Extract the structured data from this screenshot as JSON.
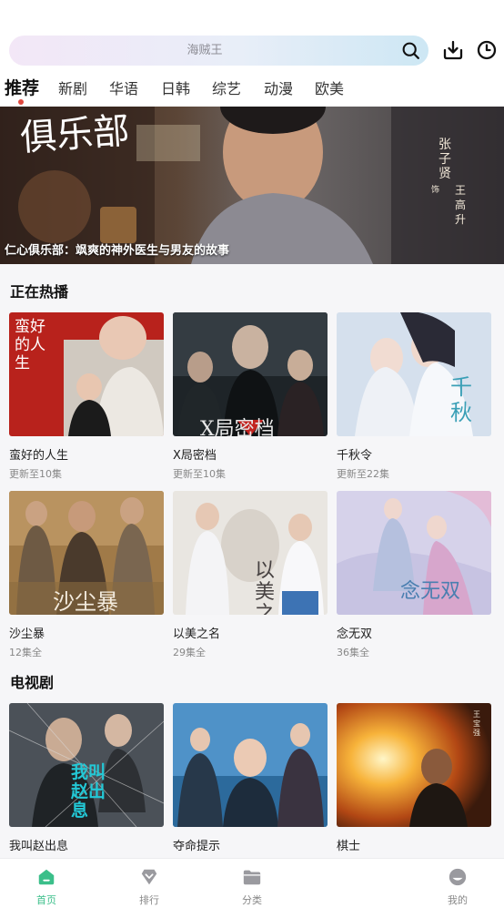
{
  "search": {
    "placeholder": "海贼王",
    "icons": [
      "search-icon",
      "download-icon",
      "history-clock-icon"
    ]
  },
  "tabs": [
    {
      "label": "推荐",
      "active": true
    },
    {
      "label": "新剧",
      "active": false
    },
    {
      "label": "华语",
      "active": false
    },
    {
      "label": "日韩",
      "active": false
    },
    {
      "label": "综艺",
      "active": false
    },
    {
      "label": "动漫",
      "active": false
    },
    {
      "label": "欧美",
      "active": false
    }
  ],
  "banner": {
    "caption": "仁心俱乐部：飒爽的神外医生与男友的故事",
    "art_text": {
      "logo": "俱乐部",
      "actor": "张子贤",
      "role_marker": "饰",
      "role": "王高升"
    }
  },
  "sections": [
    {
      "title": "正在热播",
      "items": [
        {
          "title": "蛮好的人生",
          "subtitle": "更新至10集",
          "poster_text": "蛮好的人生"
        },
        {
          "title": "X局密档",
          "subtitle": "更新至10集",
          "poster_text": "X局密档"
        },
        {
          "title": "千秋令",
          "subtitle": "更新至22集",
          "poster_text": "千秋"
        },
        {
          "title": "沙尘暴",
          "subtitle": "12集全",
          "poster_text": "沙尘暴"
        },
        {
          "title": "以美之名",
          "subtitle": "29集全",
          "poster_text": "以美之名"
        },
        {
          "title": "念无双",
          "subtitle": "36集全",
          "poster_text": "念无双"
        }
      ]
    },
    {
      "title": "电视剧",
      "items": [
        {
          "title": "我叫赵出息",
          "subtitle": "",
          "poster_text": "我叫赵出息"
        },
        {
          "title": "夺命提示",
          "subtitle": "",
          "poster_text": ""
        },
        {
          "title": "棋士",
          "subtitle": "",
          "poster_text": "王宝强"
        }
      ]
    }
  ],
  "bottom_nav": [
    {
      "label": "首页",
      "icon": "home-icon",
      "active": true
    },
    {
      "label": "排行",
      "icon": "ranking-heart-icon",
      "active": false
    },
    {
      "label": "分类",
      "icon": "folder-icon",
      "active": false
    },
    {
      "label": "我的",
      "icon": "profile-icon",
      "active": false
    }
  ],
  "colors": {
    "accent": "#3bbf8a",
    "active_dot": "#e0483e"
  }
}
